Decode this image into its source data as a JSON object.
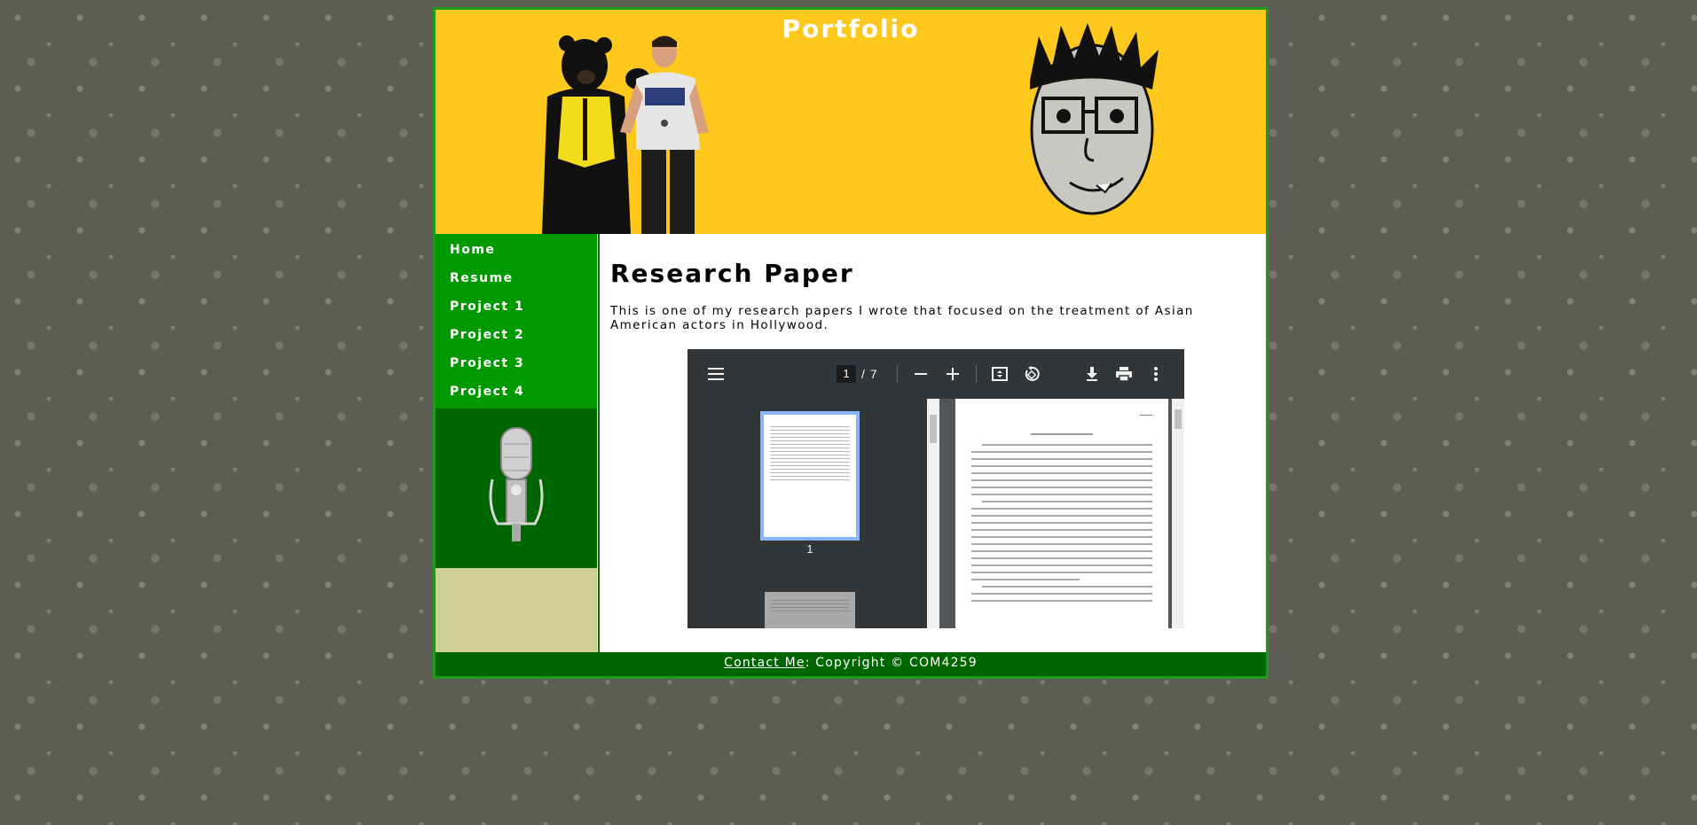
{
  "header": {
    "title": "Portfolio"
  },
  "nav": {
    "items": [
      {
        "label": "Home"
      },
      {
        "label": "Resume"
      },
      {
        "label": "Project 1"
      },
      {
        "label": "Project 2"
      },
      {
        "label": "Project 3"
      },
      {
        "label": "Project 4"
      }
    ]
  },
  "main": {
    "title": "Research Paper",
    "intro": "This is one of my research papers I wrote that focused on the treatment of Asian American actors in Hollywood."
  },
  "pdf_viewer": {
    "current_page": "1",
    "page_separator": "/",
    "total_pages": "7",
    "thumbnail_label": "1",
    "icons": [
      "menu-icon",
      "zoom-out-icon",
      "zoom-in-icon",
      "fit-page-icon",
      "rotate-icon",
      "download-icon",
      "print-icon",
      "more-options-icon"
    ]
  },
  "footer": {
    "contact_link": "Contact Me",
    "copyright": ": Copyright © COM4259"
  },
  "colors": {
    "banner": "#fec81c",
    "nav": "#009a00",
    "dark_green": "#006600",
    "side_fill": "#cfcf98",
    "border": "#1f9a1f"
  }
}
